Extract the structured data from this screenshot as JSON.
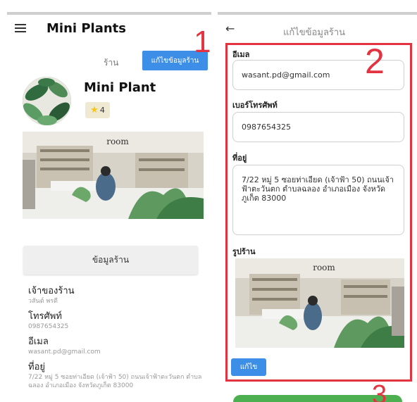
{
  "left_panel": {
    "app_title": "Mini Plants",
    "shop_label": "ร้าน",
    "edit_shop_button": "แก้ไขข้อมูลร้าน",
    "shop_name": "Mini Plant",
    "rating": "4",
    "info_button": "ข้อมูลร้าน",
    "info": [
      {
        "label": "เจ้าของร้าน",
        "value": "วสันต์ พรดี"
      },
      {
        "label": "โทรศัพท์",
        "value": "0987654325"
      },
      {
        "label": "อีเมล",
        "value": "wasant.pd@gmail.com"
      },
      {
        "label": "ที่อยู่",
        "value": "7/22 หมู่ 5 ซอยท่าเอียด (เจ้าฟ้า 50) ถนนเจ้าฟ้าตะวันตก ตำบลฉลอง อำเภอเมือง จังหวัดภูเก็ต 83000"
      }
    ],
    "photo_sign": "room"
  },
  "right_panel": {
    "title": "แก้ไขข้อมูลร้าน",
    "email_label": "อีเมล",
    "email_value": "wasant.pd@gmail.com",
    "phone_label": "เบอร์โทรศัพท์",
    "phone_value": "0987654325",
    "address_label": "ที่อยู่",
    "address_value": "7/22 หมู่ 5 ซอยท่าเอียด (เจ้าฟ้า 50) ถนนเจ้าฟ้าตะวันตก ตำบลฉลอง อำเภอเมือง จังหวัดภูเก็ต 83000",
    "photo_label": "รูปร้าน",
    "edit_button": "แก้ไข",
    "photo_sign": "room"
  },
  "annotations": {
    "step1": "1",
    "step2": "2",
    "step3": "3"
  },
  "colors": {
    "accent_blue": "#3d8ee6",
    "annotation_red": "#e33240",
    "save_green": "#4caf50",
    "star_yellow": "#f5c518"
  },
  "icons": {
    "menu": "hamburger-menu-icon",
    "back": "arrow-left-icon",
    "star": "star-icon"
  }
}
